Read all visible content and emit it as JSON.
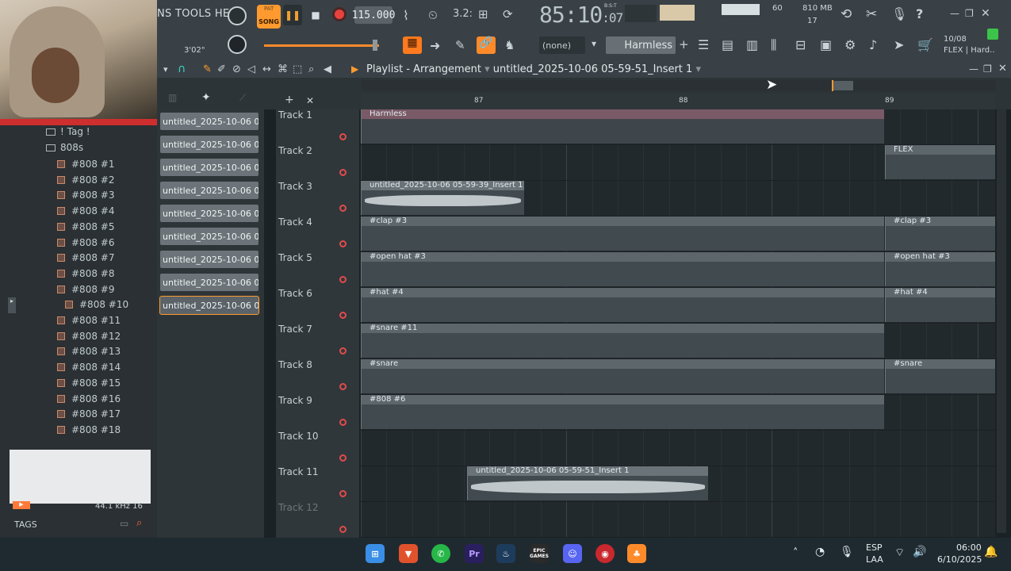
{
  "menu": {
    "text": "NS TOOLS HELP"
  },
  "transport": {
    "mode_top": "PAT",
    "mode": "SONG",
    "tempo": "115.000",
    "time": "85:10",
    "time_sub": ":07",
    "time_tag": "B:S:T",
    "clock": "3'02\""
  },
  "monitor": {
    "cpu": "60",
    "mem": "810 MB",
    "poly": "17"
  },
  "pattern": {
    "selector": "(none)",
    "current": "Harmless"
  },
  "hint": {
    "line1": "10/08",
    "line2": "FLEX | Hard.."
  },
  "playlist": {
    "title": "Playlist - Arrangement",
    "separator": "›",
    "clip_name": "untitled_2025-10-06 05-59-51_Insert 1"
  },
  "ruler": {
    "marks": [
      "87",
      "88",
      "89"
    ]
  },
  "browser": {
    "tag_label": "! Tag !",
    "folder": "808s",
    "items": [
      "#808 #1",
      "#808 #2",
      "#808 #3",
      "#808 #4",
      "#808 #5",
      "#808 #6",
      "#808 #7",
      "#808 #8",
      "#808 #9",
      "#808 #10",
      "#808 #11",
      "#808 #12",
      "#808 #13",
      "#808 #14",
      "#808 #15",
      "#808 #16",
      "#808 #17",
      "#808 #18"
    ],
    "sample_info": "44.1 kHz 16",
    "tags_label": "TAGS"
  },
  "channels": [
    "untitled_2025-10-06 05-...",
    "untitled_2025-10-06 05-...",
    "untitled_2025-10-06 05-...",
    "untitled_2025-10-06 05-...",
    "untitled_2025-10-06 05-...",
    "untitled_2025-10-06 05-...",
    "untitled_2025-10-06 05-...",
    "untitled_2025-10-06 05-...",
    "untitled_2025-10-06 05-..."
  ],
  "tracks": [
    "Track 1",
    "Track 2",
    "Track 3",
    "Track 4",
    "Track 5",
    "Track 6",
    "Track 7",
    "Track 8",
    "Track 9",
    "Track 10",
    "Track 11",
    "Track 12"
  ],
  "clips": {
    "harmless": "Harmless",
    "flex": "FLEX",
    "audio1": "untitled_2025-10-06 05-59-39_Insert 1",
    "clap": "#clap #3",
    "clap2": "#clap #3",
    "openhat": "#open hat #3",
    "openhat2": "#open hat #3",
    "hat": "#hat #4",
    "hat2": "#hat #4",
    "snare11": "#snare #11",
    "snare": "#snare",
    "snare2": "#snare",
    "k808": "#808 #6",
    "audio2": "untitled_2025-10-06 05-59-51_Insert 1"
  },
  "taskbar": {
    "lang1": "ESP",
    "lang2": "LAA",
    "time": "06:00",
    "date": "6/10/2025",
    "epic": "EPIC\nGAMES",
    "premiere": "Pr"
  }
}
